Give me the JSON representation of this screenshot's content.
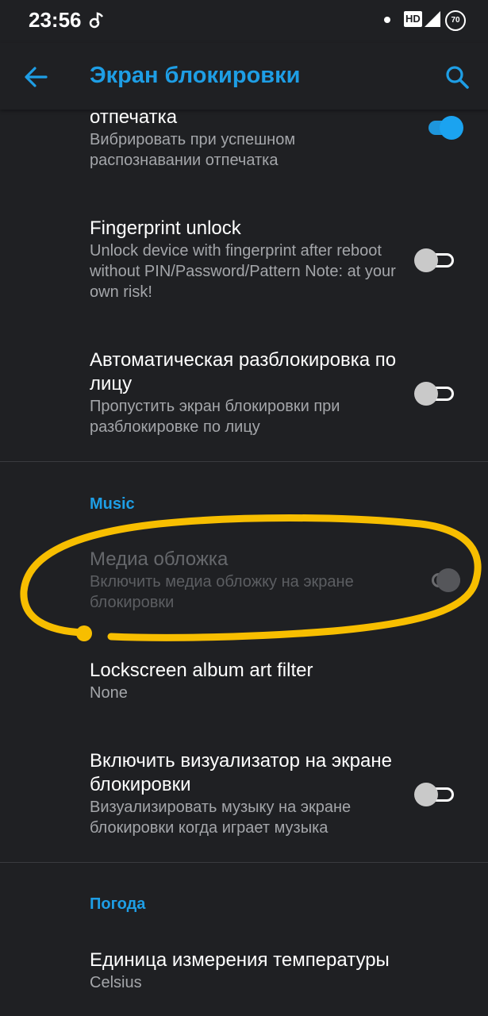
{
  "status_bar": {
    "time": "23:56",
    "hd_badge": "HD",
    "battery_level": "70"
  },
  "app_bar": {
    "title": "Экран блокировки",
    "back_icon": "arrow-left-icon",
    "search_icon": "search-icon"
  },
  "colors": {
    "accent": "#1e9ee5",
    "background": "#1f2023",
    "annotation": "#f7be00"
  },
  "prefs": [
    {
      "title": "отпечатка",
      "summary": "Вибрировать при успешном распознавании отпечатка",
      "toggle": "on"
    },
    {
      "title": "Fingerprint unlock",
      "summary": "Unlock device with fingerprint after reboot without PIN/Password/Pattern Note: at your own risk!",
      "toggle": "off"
    },
    {
      "title": "Автоматическая разблокировка по лицу",
      "summary": "Пропустить экран блокировки при разблокировке по лицу",
      "toggle": "off"
    }
  ],
  "music": {
    "header": "Music",
    "prefs": [
      {
        "title": "Медиа обложка",
        "summary": "Включить медиа обложку на экране блокировки",
        "toggle": "on",
        "enabled": false
      },
      {
        "title": "Lockscreen album art filter",
        "summary": "None"
      },
      {
        "title": "Включить визуализатор на экране блокировки",
        "summary": "Визуализировать музыку на экране блокировки когда играет музыка",
        "toggle": "off"
      }
    ]
  },
  "weather": {
    "header": "Погода",
    "prefs": [
      {
        "title": "Единица измерения температуры",
        "summary": "Celsius"
      }
    ]
  }
}
